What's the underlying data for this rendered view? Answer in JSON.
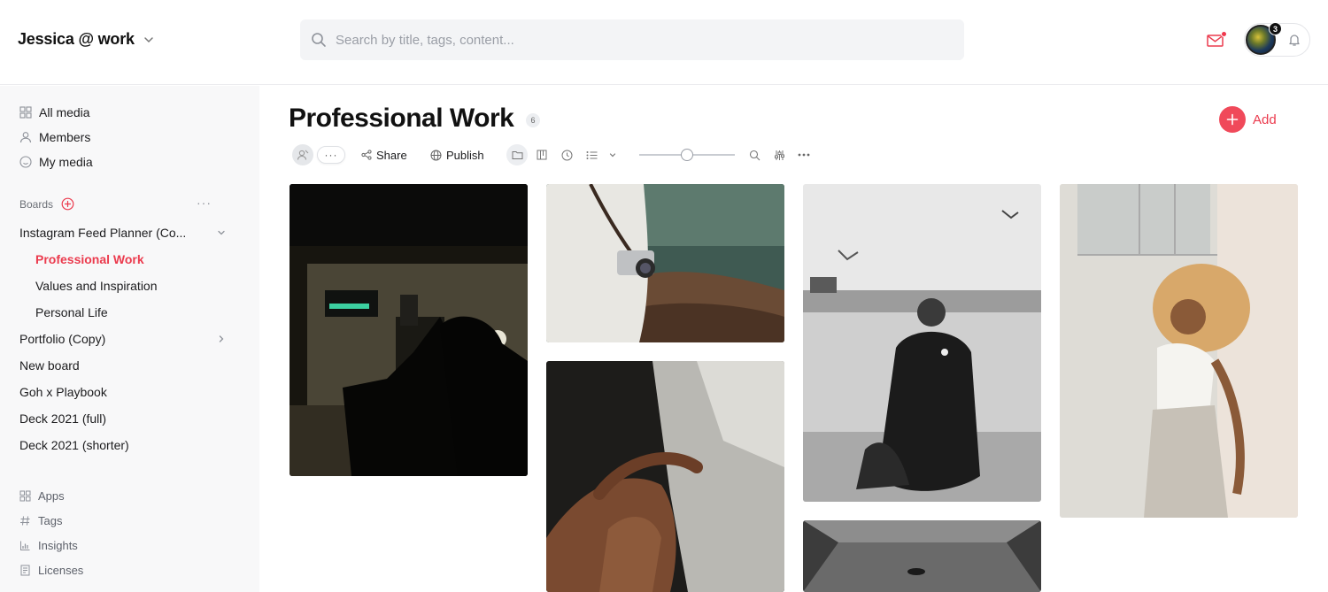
{
  "header": {
    "workspace_name": "Jessica @ work",
    "search_placeholder": "Search by title, tags, content...",
    "notification_count": "3"
  },
  "sidebar": {
    "nav": [
      {
        "label": "All media",
        "icon": "grid-icon"
      },
      {
        "label": "Members",
        "icon": "person-icon"
      },
      {
        "label": "My media",
        "icon": "smile-icon"
      }
    ],
    "boards_label": "Boards",
    "boards": [
      {
        "label": "Instagram Feed Planner (Co...",
        "expanded": true
      },
      {
        "label": "Professional Work",
        "active": true
      },
      {
        "label": "Values and Inspiration"
      },
      {
        "label": "Personal Life"
      },
      {
        "label": "Portfolio (Copy)"
      },
      {
        "label": "New board"
      },
      {
        "label": "Goh x Playbook"
      },
      {
        "label": "Deck 2021 (full)"
      },
      {
        "label": "Deck 2021 (shorter)"
      }
    ],
    "utilities": [
      {
        "label": "Apps",
        "icon": "apps-icon"
      },
      {
        "label": "Tags",
        "icon": "hash-icon"
      },
      {
        "label": "Insights",
        "icon": "chart-icon"
      },
      {
        "label": "Licenses",
        "icon": "license-icon"
      }
    ]
  },
  "main": {
    "title": "Professional Work",
    "count": "6",
    "add_label": "Add",
    "toolbar": {
      "more_label": "···",
      "share_label": "Share",
      "publish_label": "Publish",
      "size_level": 0.5
    }
  },
  "colors": {
    "accent": "#eb3b4e",
    "sidebar_bg": "#f8f8f9",
    "search_bg": "#f3f4f6"
  }
}
